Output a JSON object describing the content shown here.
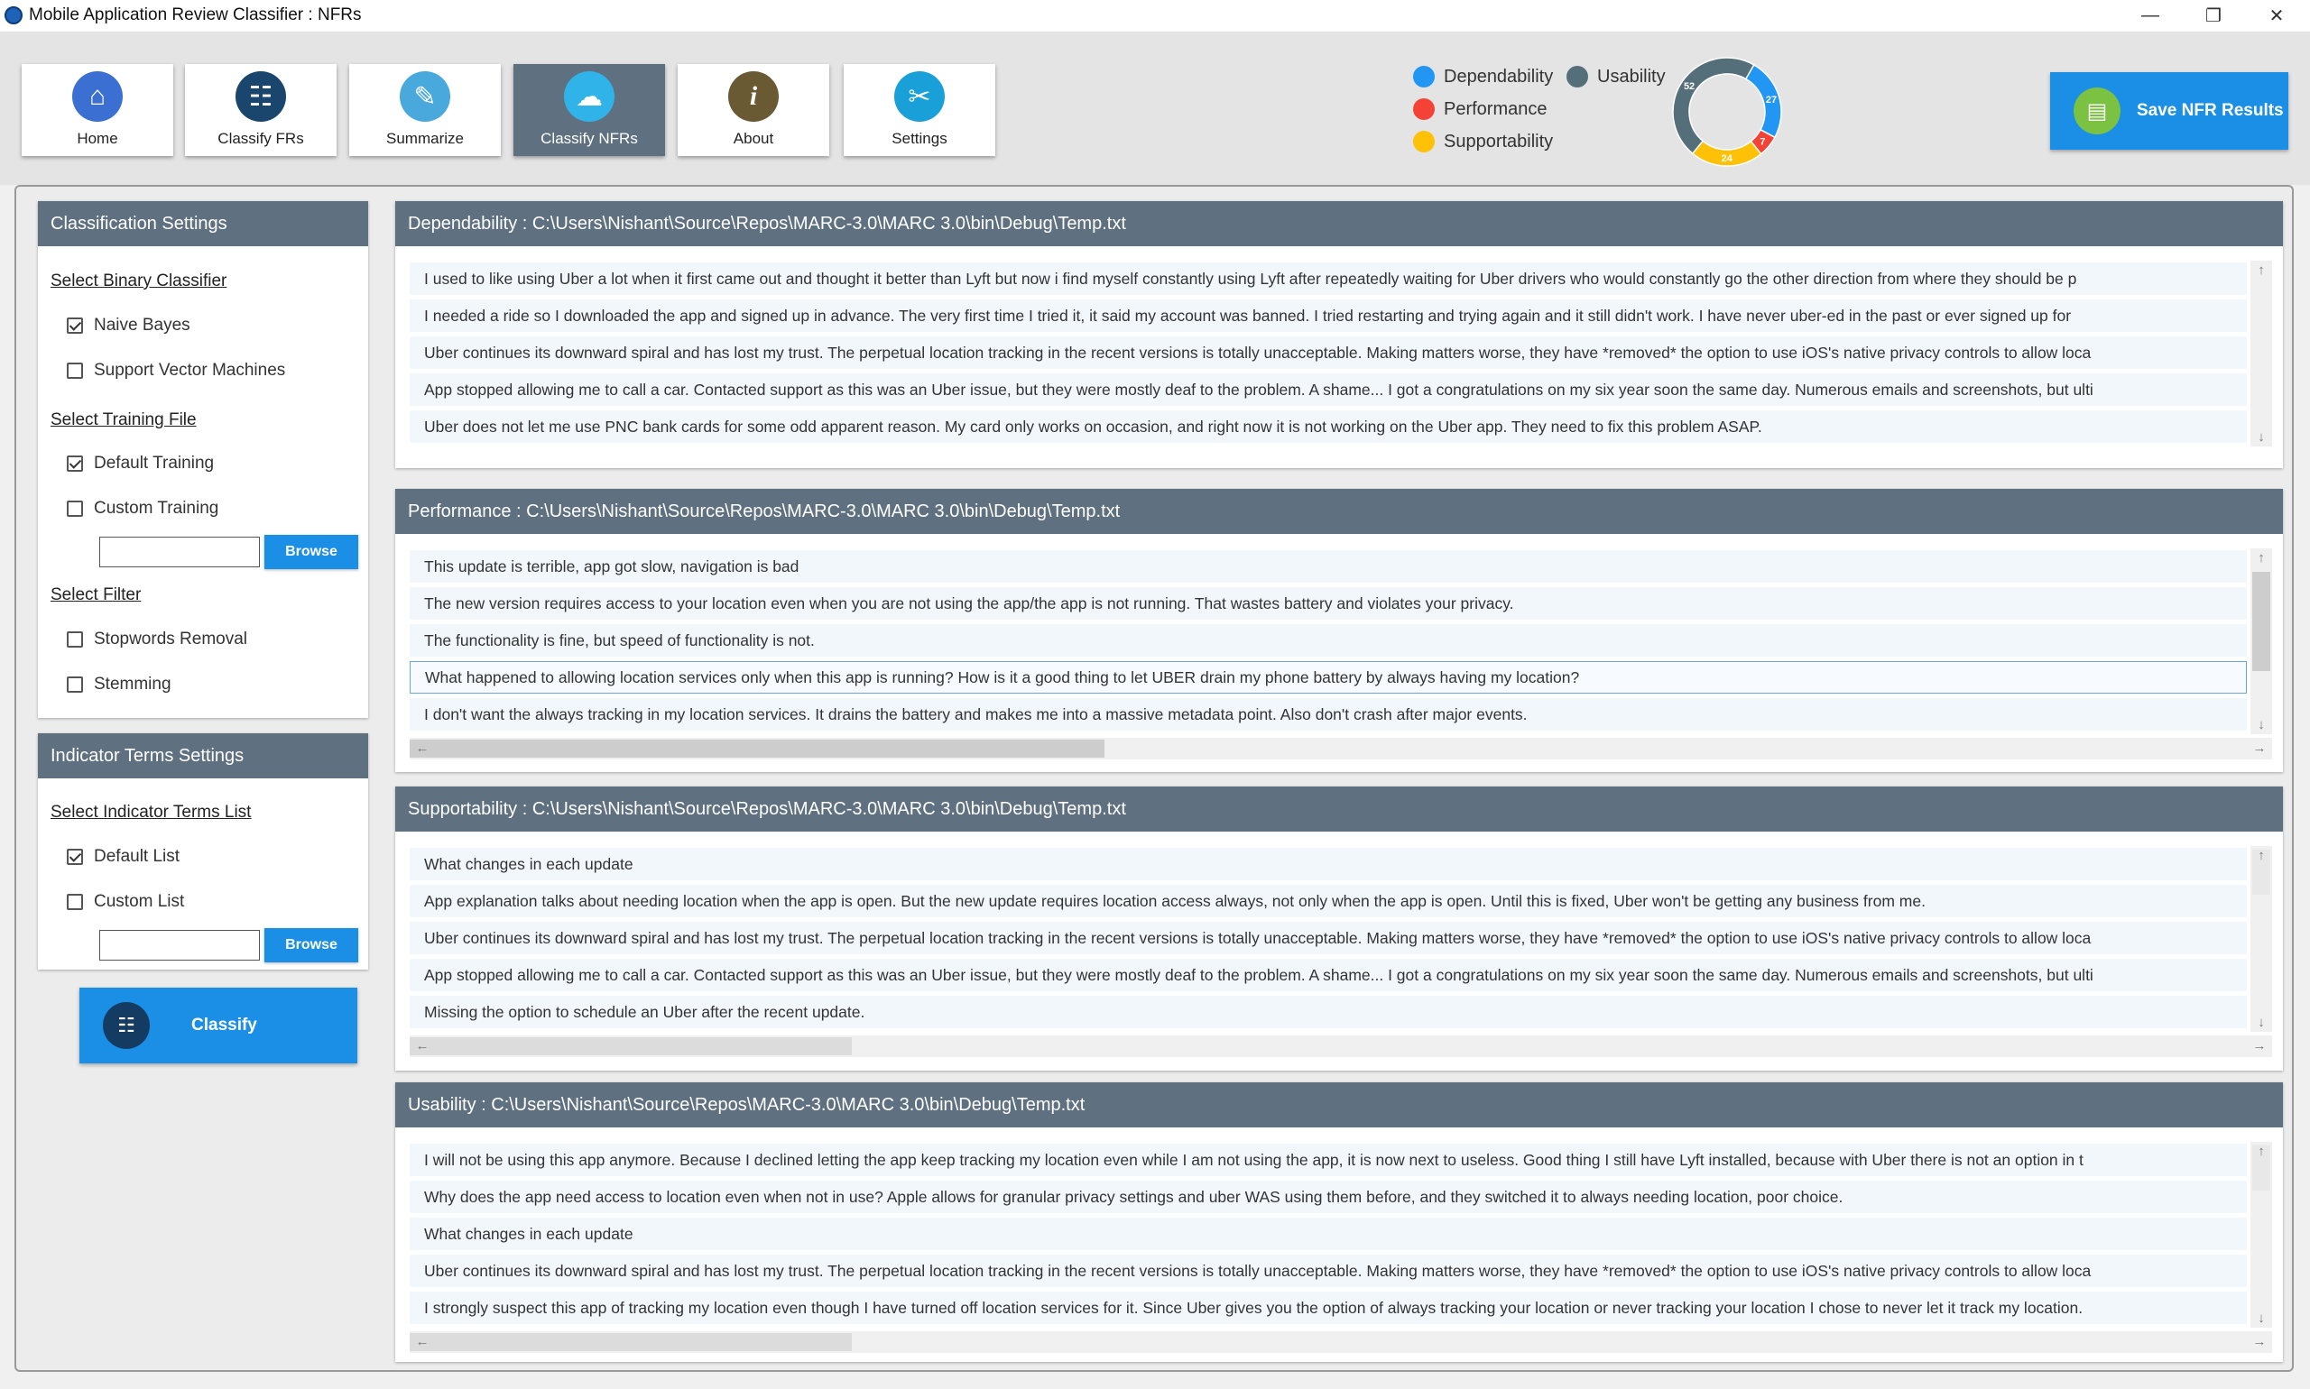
{
  "window": {
    "title": "Mobile Application Review Classifier : NFRs",
    "minimize": "—",
    "maximize": "❐",
    "close": "✕"
  },
  "toolbar": {
    "buttons": [
      {
        "label": "Home",
        "icon": "home-icon",
        "glyph": "⌂",
        "color": "#3b6fd1"
      },
      {
        "label": "Classify FRs",
        "icon": "classify-frs-icon",
        "glyph": "☷",
        "color": "#1a466e"
      },
      {
        "label": "Summarize",
        "icon": "summarize-icon",
        "glyph": "✎",
        "color": "#49a9dc"
      },
      {
        "label": "Classify NFRs",
        "icon": "classify-nfrs-icon",
        "glyph": "☁",
        "color": "#2fb3e8"
      },
      {
        "label": "About",
        "icon": "info-icon",
        "glyph": "i",
        "color": "#6a5a34"
      },
      {
        "label": "Settings",
        "icon": "settings-icon",
        "glyph": "✂",
        "color": "#1aa0d8"
      }
    ]
  },
  "legend": {
    "dependability": "Dependability",
    "usability": "Usability",
    "performance": "Performance",
    "supportability": "Supportability"
  },
  "colors": {
    "dependability": "#2196f3",
    "usability": "#546e7a",
    "performance": "#f44336",
    "supportability": "#ffc107",
    "accent": "#1b8fe6",
    "header": "#5f7080"
  },
  "chart_data": {
    "type": "pie",
    "donut": true,
    "categories": [
      "Usability",
      "Dependability",
      "Performance",
      "Supportability"
    ],
    "values": [
      52,
      27,
      7,
      24
    ],
    "value_labels": [
      "52",
      "27",
      "7",
      "24"
    ]
  },
  "save": {
    "label": "Save NFR Results",
    "icon": "save-file-icon"
  },
  "classification_settings": {
    "header": "Classification Settings",
    "binary_classifier_label": "Select Binary Classifier",
    "naive_bayes": "Naive Bayes",
    "svm": "Support Vector Machines",
    "training_file_label": "Select Training File",
    "default_training": "Default Training",
    "custom_training": "Custom Training",
    "training_path": "",
    "browse": "Browse",
    "filter_label": "Select Filter",
    "stopwords": "Stopwords Removal",
    "stemming": "Stemming"
  },
  "indicator_settings": {
    "header": "Indicator Terms Settings",
    "list_label": "Select Indicator Terms List",
    "default_list": "Default List",
    "custom_list": "Custom List",
    "list_path": "",
    "browse": "Browse"
  },
  "classify": {
    "label": "Classify",
    "icon": "classify-icon"
  },
  "sections": {
    "dependability": {
      "header": "Dependability : C:\\Users\\Nishant\\Source\\Repos\\MARC-3.0\\MARC 3.0\\bin\\Debug\\Temp.txt",
      "rows": [
        "I used to like using Uber a lot when it first came out and thought it better than Lyft but now i find myself constantly using Lyft after repeatedly waiting for Uber drivers who would constantly go the other direction from where they should be p",
        "I needed a ride so I downloaded the app and signed up in advance. The very first time I tried it, it said my account was banned. I tried restarting and trying again and it still didn't work. I have never uber-ed in the past or ever signed up for",
        "Uber continues its downward spiral and has lost my trust. The perpetual location tracking in the recent versions is totally unacceptable. Making matters worse, they have *removed* the option to use iOS's native privacy controls to allow loca",
        "App stopped allowing me to call a car. Contacted support as this was an Uber issue, but they were mostly deaf to the problem. A shame... I got a congratulations on my six year soon the same day. Numerous emails and screenshots, but ulti",
        "Uber does not let me use PNC bank cards for some odd apparent reason. My card only works on occasion, and right now it is not working on the Uber app. They need to fix this problem ASAP."
      ]
    },
    "performance": {
      "header": "Performance : C:\\Users\\Nishant\\Source\\Repos\\MARC-3.0\\MARC 3.0\\bin\\Debug\\Temp.txt",
      "rows": [
        "This update is terrible, app got slow, navigation is bad",
        "The new version requires access to your location even when you are not using the app/the app is not running. That wastes battery and violates your privacy.",
        "The functionality is fine, but speed of functionality is not.",
        "What happened to allowing location services only when this app is running?  How is it a good thing to let UBER drain my phone battery by always having my location?",
        "I don't want the always tracking in my location services. It drains the battery and makes me into a massive metadata point. Also don't crash after major events."
      ]
    },
    "supportability": {
      "header": "Supportability : C:\\Users\\Nishant\\Source\\Repos\\MARC-3.0\\MARC 3.0\\bin\\Debug\\Temp.txt",
      "rows": [
        "What changes in each update",
        "App explanation talks about needing location when the app is open. But the new update requires location access always, not only when the app is open. Until this is fixed, Uber won't be getting any business from me.",
        "Uber continues its downward spiral and has lost my trust. The perpetual location tracking in the recent versions is totally unacceptable. Making matters worse, they have *removed* the option to use iOS's native privacy controls to allow loca",
        "App stopped allowing me to call a car. Contacted support as this was an Uber issue, but they were mostly deaf to the problem. A shame... I got a congratulations on my six year soon the same day. Numerous emails and screenshots, but ulti",
        "Missing the option to schedule an Uber after the recent update."
      ]
    },
    "usability": {
      "header": "Usability : C:\\Users\\Nishant\\Source\\Repos\\MARC-3.0\\MARC 3.0\\bin\\Debug\\Temp.txt",
      "rows": [
        "I will not be using this app anymore. Because I declined letting the app keep tracking my location even while I am not using the app, it is now next to useless. Good thing I still have Lyft installed, because with Uber there is not an option in t",
        "Why does the app need access to location even when not in use? Apple allows for granular privacy settings and uber WAS using them before, and they switched it to always needing location, poor choice.",
        "What changes in each update",
        "Uber continues its downward spiral and has lost my trust. The perpetual location tracking in the recent versions is totally unacceptable. Making matters worse, they have *removed* the option to use iOS's native privacy controls to allow loca",
        "I strongly suspect this app of tracking my location even though I have turned off location services for it. Since Uber gives you the option of always tracking your location or never tracking your location I chose to never let it track my location."
      ]
    }
  }
}
